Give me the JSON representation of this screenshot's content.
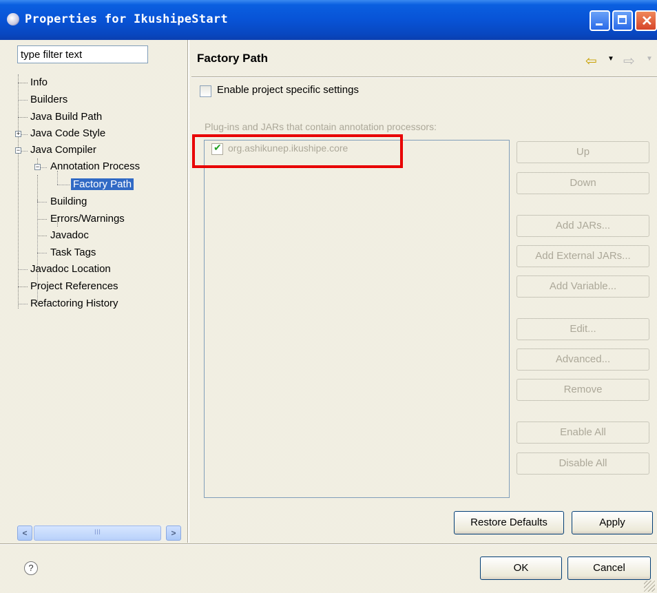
{
  "window": {
    "title": "Properties for IkushipeStart"
  },
  "left_pane": {
    "filter": {
      "placeholder": "type filter text",
      "value": "type filter text"
    },
    "tree": [
      {
        "label": "Info"
      },
      {
        "label": "Builders"
      },
      {
        "label": "Java Build Path"
      },
      {
        "label": "Java Code Style",
        "expander": "+"
      },
      {
        "label": "Java Compiler",
        "expander": "−"
      },
      {
        "label": "Annotation Process",
        "expander": "−"
      },
      {
        "label": "Factory Path",
        "selected": true
      },
      {
        "label": "Building"
      },
      {
        "label": "Errors/Warnings"
      },
      {
        "label": "Javadoc"
      },
      {
        "label": "Task Tags"
      },
      {
        "label": "Javadoc Location"
      },
      {
        "label": "Project References"
      },
      {
        "label": "Refactoring History"
      }
    ],
    "scrollbar": {
      "left": "<",
      "right": ">",
      "thumb": "III"
    }
  },
  "page": {
    "title": "Factory Path",
    "enable_project_settings": {
      "label": "Enable project specific settings",
      "checked": false
    },
    "jar_group_label": "Plug-ins and JARs that contain annotation processors:",
    "jars": [
      {
        "label": "org.ashikunep.ikushipe.core",
        "checked": true
      }
    ],
    "side_buttons": [
      {
        "label": "Up"
      },
      {
        "label": "Down"
      },
      {
        "label": "Add JARs..."
      },
      {
        "label": "Add External JARs..."
      },
      {
        "label": "Add Variable..."
      },
      {
        "label": "Edit..."
      },
      {
        "label": "Advanced..."
      },
      {
        "label": "Remove"
      },
      {
        "label": "Enable All"
      },
      {
        "label": "Disable All"
      }
    ],
    "restore_defaults_label": "Restore Defaults",
    "apply_label": "Apply"
  },
  "footer": {
    "help": "?",
    "ok_label": "OK",
    "cancel_label": "Cancel"
  },
  "colors": {
    "highlight": "#e80000",
    "selection": "#316ac5",
    "titlebar": "#0853d6"
  }
}
